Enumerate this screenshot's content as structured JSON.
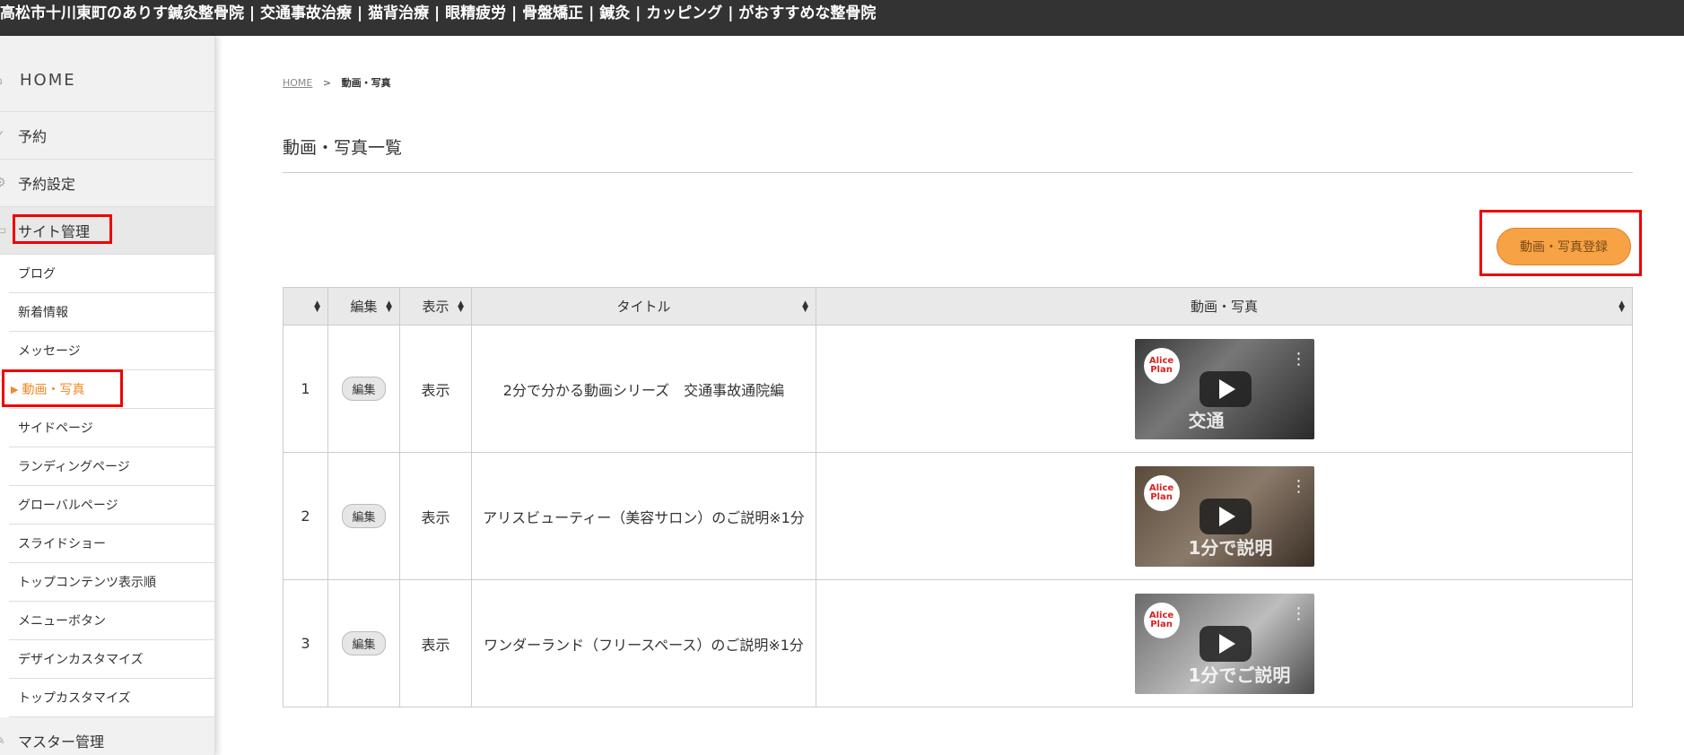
{
  "topbar": {
    "title": "高松市十川東町のありす鍼灸整骨院 | 交通事故治療 | 猫背治療 | 眼精疲労 | 骨盤矯正 | 鍼灸 | カッピング | がおすすめな整骨院"
  },
  "sidebar": {
    "home": "HOME",
    "reserve": "予約",
    "reserve_settings": "予約設定",
    "site_admin": "サイト管理",
    "sub_items": [
      "ブログ",
      "新着情報",
      "メッセージ",
      "動画・写真",
      "サイドページ",
      "ランディングページ",
      "グローバルページ",
      "スライドショー",
      "トップコンテンツ表示順",
      "メニューボタン",
      "デザインカスタマイズ",
      "トップカスタマイズ"
    ],
    "current_marker": "▶",
    "master_admin": "マスター管理"
  },
  "breadcrumb": {
    "home": "HOME",
    "sep": ">",
    "current": "動画・写真"
  },
  "page": {
    "title": "動画・写真一覧",
    "register_button": "動画・写真登録"
  },
  "table": {
    "headers": [
      "",
      "編集",
      "表示",
      "タイトル",
      "動画・写真"
    ],
    "rows": [
      {
        "no": "1",
        "edit": "編集",
        "display": "表示",
        "title": "2分で分かる動画シリーズ　交通事故通院編",
        "video_caption": "交通"
      },
      {
        "no": "2",
        "edit": "編集",
        "display": "表示",
        "title": "アリスビューティー（美容サロン）のご説明※1分",
        "video_caption": "1分で説明"
      },
      {
        "no": "3",
        "edit": "編集",
        "display": "表示",
        "title": "ワンダーランド（フリースペース）のご説明※1分",
        "video_caption": "1分でご説明"
      }
    ],
    "video_logo": "Alice Plan"
  }
}
